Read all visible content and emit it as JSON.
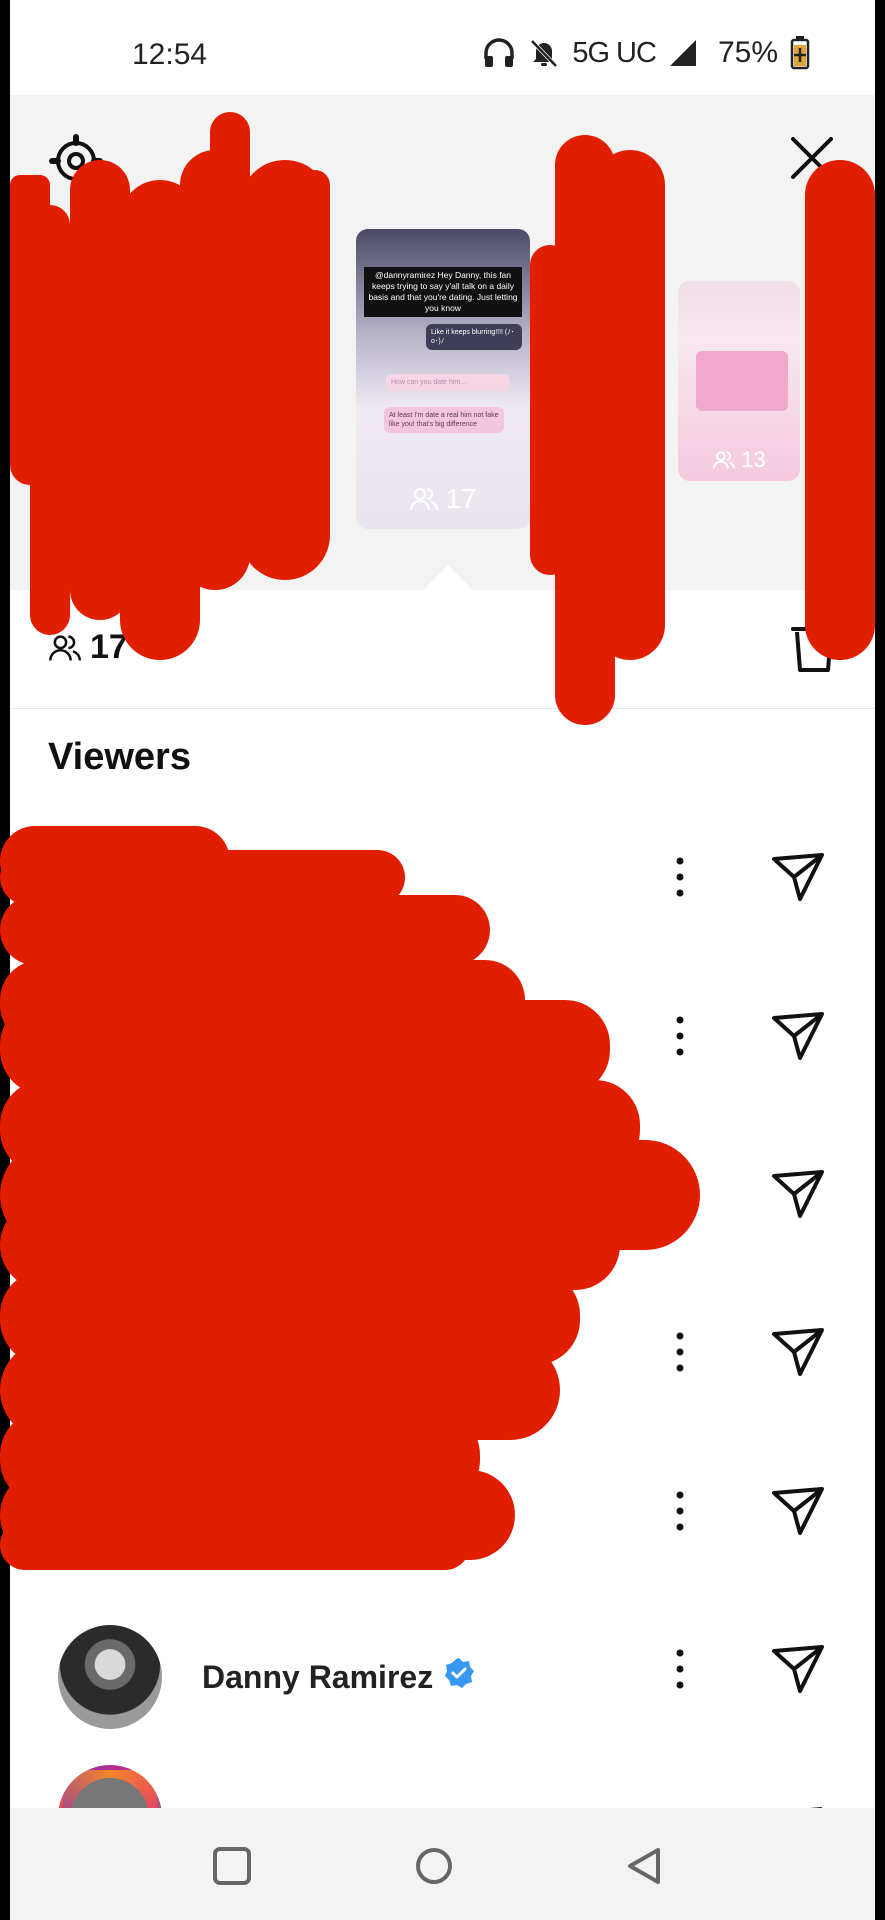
{
  "status_bar": {
    "time": "12:54",
    "network": "5G UC",
    "battery": "75%"
  },
  "story_tray": {
    "current_story": {
      "caption": "@dannyramirez Hey Danny, this fan keeps trying to say y'all talk on a daily basis and that you're dating. Just letting you know",
      "bubbles": [
        "Like it keeps blurring!!!! (ﾉ･o･)ﾉ",
        "How can you date him...",
        "At least I'm date a real him not fake like you! that's big difference"
      ],
      "view_count": "17"
    },
    "next_story": {
      "view_count": "13"
    }
  },
  "summary": {
    "view_count": "17"
  },
  "viewers": {
    "title": "Viewers",
    "rows": [
      {
        "name": ""
      },
      {
        "name": ""
      },
      {
        "name": ""
      },
      {
        "name": ""
      },
      {
        "name": ""
      },
      {
        "name": "Danny Ramirez",
        "verified": true
      },
      {
        "name": ""
      }
    ]
  },
  "colors": {
    "redaction": "#e11f00",
    "verified_badge": "#3897f0",
    "tray_background": "#f3f3f3"
  },
  "icons": [
    "settings-gear-icon",
    "close-icon",
    "viewers-icon",
    "trash-icon",
    "more-vertical-icon",
    "send-icon",
    "verified-badge-icon",
    "nav-square-icon",
    "nav-circle-icon",
    "nav-back-icon"
  ]
}
